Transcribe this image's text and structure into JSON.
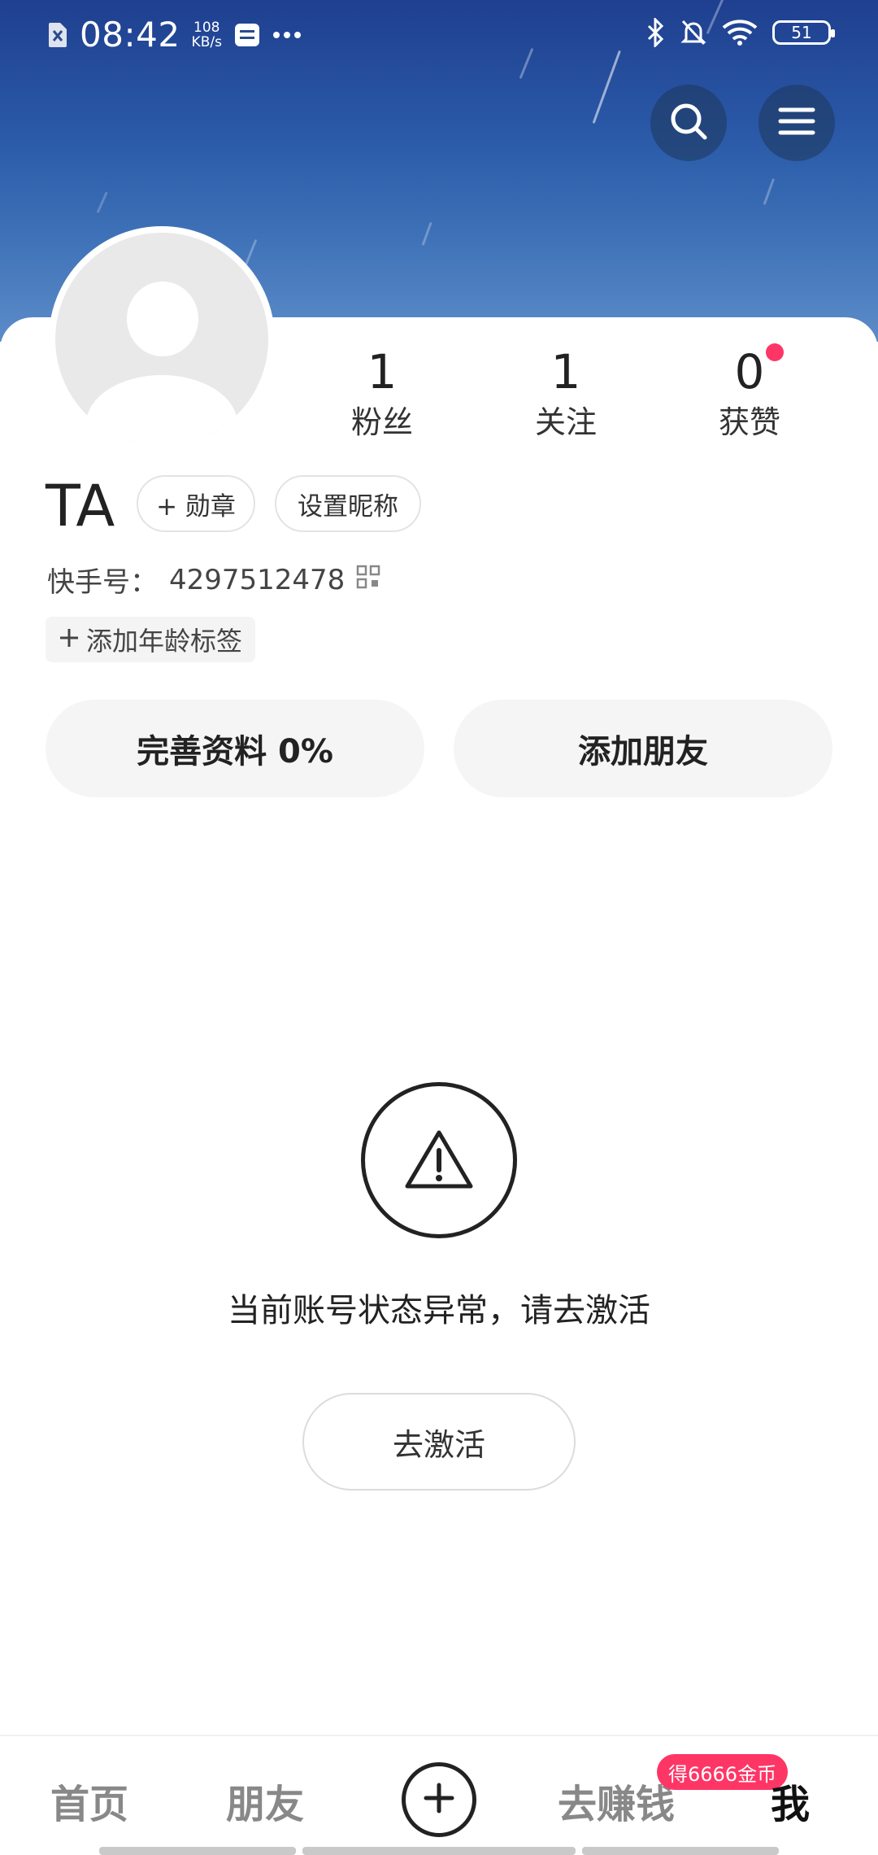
{
  "status_bar": {
    "time": "08:42",
    "net_speed_value": "108",
    "net_speed_unit": "KB/s",
    "battery": "51",
    "icons": [
      "sim-off-icon",
      "message-icon",
      "more-dots-icon",
      "bluetooth-icon",
      "mute-bell-icon",
      "wifi-icon",
      "battery-icon"
    ]
  },
  "header": {
    "search_icon": "search-icon",
    "menu_icon": "hamburger-menu-icon"
  },
  "profile": {
    "stats": [
      {
        "value": "1",
        "label": "粉丝"
      },
      {
        "value": "1",
        "label": "关注"
      },
      {
        "value": "0",
        "label": "获赞"
      }
    ],
    "name": "TA",
    "medal_chip": "+ 勋章",
    "set_nickname_chip": "设置昵称",
    "id_label": "快手号：",
    "id_value": "4297512478",
    "age_tag": "添加年龄标签",
    "complete_profile_btn": "完善资料 0%",
    "add_friend_btn": "添加朋友"
  },
  "warning": {
    "message": "当前账号状态异常，请去激活",
    "activate_btn": "去激活"
  },
  "bottom_nav": {
    "items": [
      "首页",
      "朋友",
      "去赚钱",
      "我"
    ],
    "badge": "得6666金币",
    "active": "我"
  },
  "colors": {
    "accent_red": "#fe3666",
    "header_blue": "#2a5aa8"
  }
}
